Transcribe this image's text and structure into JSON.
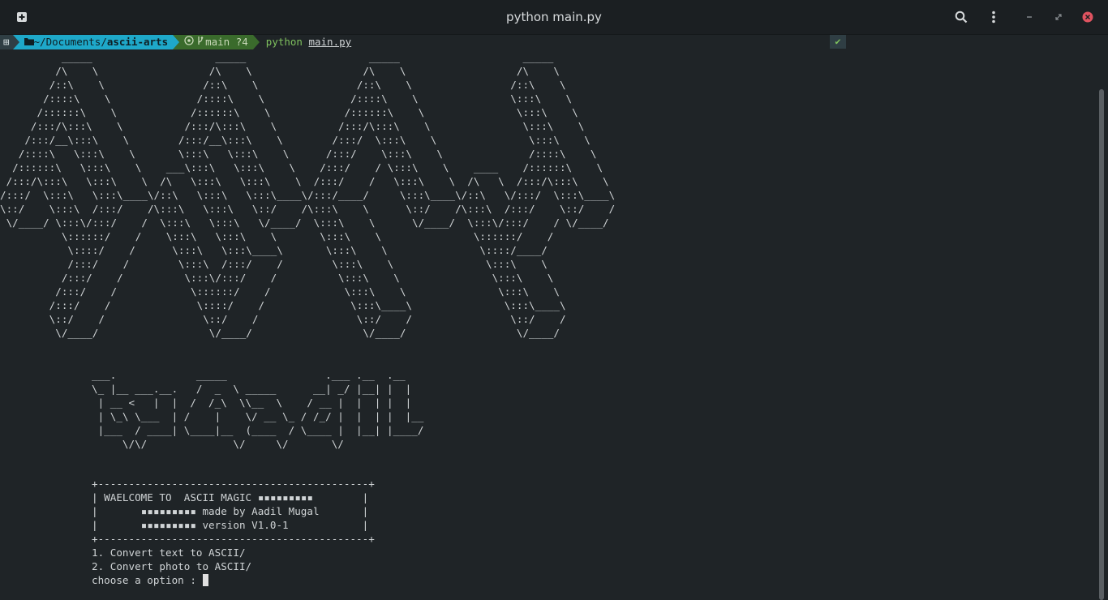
{
  "window": {
    "title": "python main.py",
    "icons": [
      "new-tab-icon",
      "search-icon",
      "menu-icon",
      "minimize-icon",
      "maximize-icon",
      "close-icon"
    ]
  },
  "prompt": {
    "os_glyph": "⊞",
    "dir_prefix": "~/Documents/",
    "dir_name": "ascii-arts",
    "git_branch": "main ?4",
    "command": "python",
    "argument": "main.py",
    "status": "✔"
  },
  "terminal": {
    "art_big": "          _____                    _____                    _____                    _____\n         /\\    \\                  /\\    \\                  /\\    \\                  /\\    \\\n        /::\\    \\                /::\\    \\                /::\\    \\                /::\\    \\\n       /::::\\    \\              /::::\\    \\              /::::\\    \\               \\:::\\    \\\n      /::::::\\    \\            /::::::\\    \\            /::::::\\    \\               \\:::\\    \\\n     /:::/\\:::\\    \\          /:::/\\:::\\    \\          /:::/\\:::\\    \\               \\:::\\    \\\n    /:::/__\\:::\\    \\        /:::/__\\:::\\    \\        /:::/  \\:::\\    \\               \\:::\\    \\\n   /::::\\   \\:::\\    \\       \\:::\\   \\:::\\    \\      /:::/    \\:::\\    \\              /::::\\    \\\n  /::::::\\   \\:::\\    \\    ___\\:::\\   \\:::\\    \\    /:::/    / \\:::\\    \\    ____    /::::::\\    \\\n /:::/\\:::\\   \\:::\\    \\  /\\   \\:::\\   \\:::\\    \\  /:::/    /   \\:::\\    \\  /\\   \\  /:::/\\:::\\    \\\n/:::/  \\:::\\   \\:::\\____\\/::\\   \\:::\\   \\:::\\____\\/:::/____/     \\:::\\____\\/::\\   \\/:::/  \\:::\\____\\\n\\::/    \\:::\\  /:::/    /\\:::\\   \\:::\\   \\::/    /\\:::\\    \\      \\::/    /\\:::\\  /:::/    \\::/    /\n \\/____/ \\:::\\/:::/    /  \\:::\\   \\:::\\   \\/____/  \\:::\\    \\      \\/____/  \\:::\\/:::/    / \\/____/\n          \\::::::/    /    \\:::\\   \\:::\\    \\       \\:::\\    \\               \\::::::/    /\n           \\::::/    /      \\:::\\   \\:::\\____\\       \\:::\\    \\               \\::::/____/\n           /:::/    /        \\:::\\  /:::/    /        \\:::\\    \\               \\:::\\    \\\n          /:::/    /          \\:::\\/:::/    /          \\:::\\    \\               \\:::\\    \\\n         /:::/    /            \\::::::/    /            \\:::\\    \\               \\:::\\    \\\n        /:::/    /              \\::::/    /              \\:::\\____\\               \\:::\\____\\\n        \\::/    /                \\::/    /                \\::/    /                \\::/    /\n         \\/____/                  \\/____/                  \\/____/                  \\/____/",
    "art_banner": "___.             _____                .___ .__  .__\n\\_ |__ ___.__.   /  _  \\ _____      __| _/ |__| |  |\n | __ <   |  |  /  /_\\  \\\\__  \\    / __ |  |  | |  |\n | \\_\\ \\___  | /    |    \\/ __ \\_ / /_/ |  |  | |  |__\n |___  / ____| \\____|__  (____  / \\____ |  |__| |____/\n     \\/\\/              \\/     \\/       \\/",
    "menu_box": "+--------------------------------------------+\n| WAELCOME TO  ASCII MAGIC ▪▪▪▪▪▪▪▪▪        |\n|       ▪▪▪▪▪▪▪▪▪ made by Aadil Mugal       |\n|       ▪▪▪▪▪▪▪▪▪ version V1.0-1            |\n+--------------------------------------------+",
    "option_1": "1. Convert text to ASCII/",
    "option_2": "2. Convert photo to ASCII/",
    "input_prompt": "choose a option : "
  }
}
